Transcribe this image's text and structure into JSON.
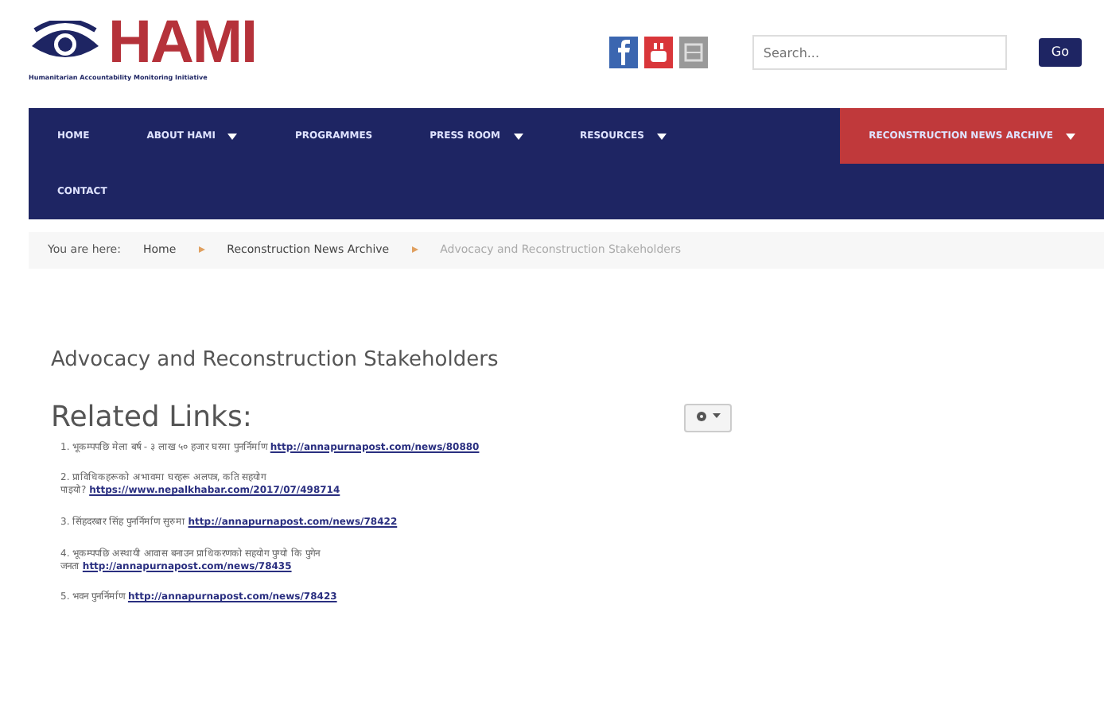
{
  "header": {
    "logo_text": "HAMI",
    "logo_tagline": "Humanitarian Accountability Monitoring Initiative",
    "search": {
      "placeholder": "Search...",
      "button": "Go"
    }
  },
  "nav": [
    {
      "label": "HOME",
      "dropdown": false,
      "selected": false
    },
    {
      "label": "ABOUT HAMI",
      "dropdown": true,
      "selected": false
    },
    {
      "label": "PROGRAMMES",
      "dropdown": false,
      "selected": false
    },
    {
      "label": "PRESS ROOM",
      "dropdown": true,
      "selected": false
    },
    {
      "label": "RESOURCES",
      "dropdown": true,
      "selected": false
    },
    {
      "label": "RECONSTRUCTION NEWS ARCHIVE",
      "dropdown": true,
      "selected": true
    },
    {
      "label": "CONTACT",
      "dropdown": false,
      "selected": false
    }
  ],
  "breadcrumb": {
    "prefix": "You are here:",
    "items": [
      "Home",
      "Reconstruction News Archive",
      "Advocacy and Reconstruction Stakeholders"
    ]
  },
  "page_title": "Advocacy and Reconstruction Stakeholders",
  "section_title": "Related Links:",
  "links": [
    {
      "number": "1.",
      "text": "भूकम्पपछि मेला बर्ष - ३ लाख ५० हजार घरमा पुनर्निर्माण",
      "url": "http://annapurnapost.com/news/80880"
    },
    {
      "number": "2.",
      "text": "प्राविधिकहरूको अभावमा घरहरू अलपत्र, कति सहयोग",
      "text2": "पाइयो?",
      "url": "https://www.nepalkhabar.com/2017/07/498714"
    },
    {
      "number": "3.",
      "text": "सिंहदरबार सिंह पुनर्निर्माण सुरुमा",
      "url": "http://annapurnapost.com/news/78422"
    },
    {
      "number": "4.",
      "text": "भूकम्पपछि अस्थायी आवास बनाउन प्राधिकरणको सहयोग पुग्यो कि पुगेन",
      "text2": "जनता",
      "url": "http://annapurnapost.com/news/78435"
    },
    {
      "number": "5.",
      "text": "भवन पुनर्निर्माण",
      "url": "http://annapurnapost.com/news/78423"
    }
  ]
}
